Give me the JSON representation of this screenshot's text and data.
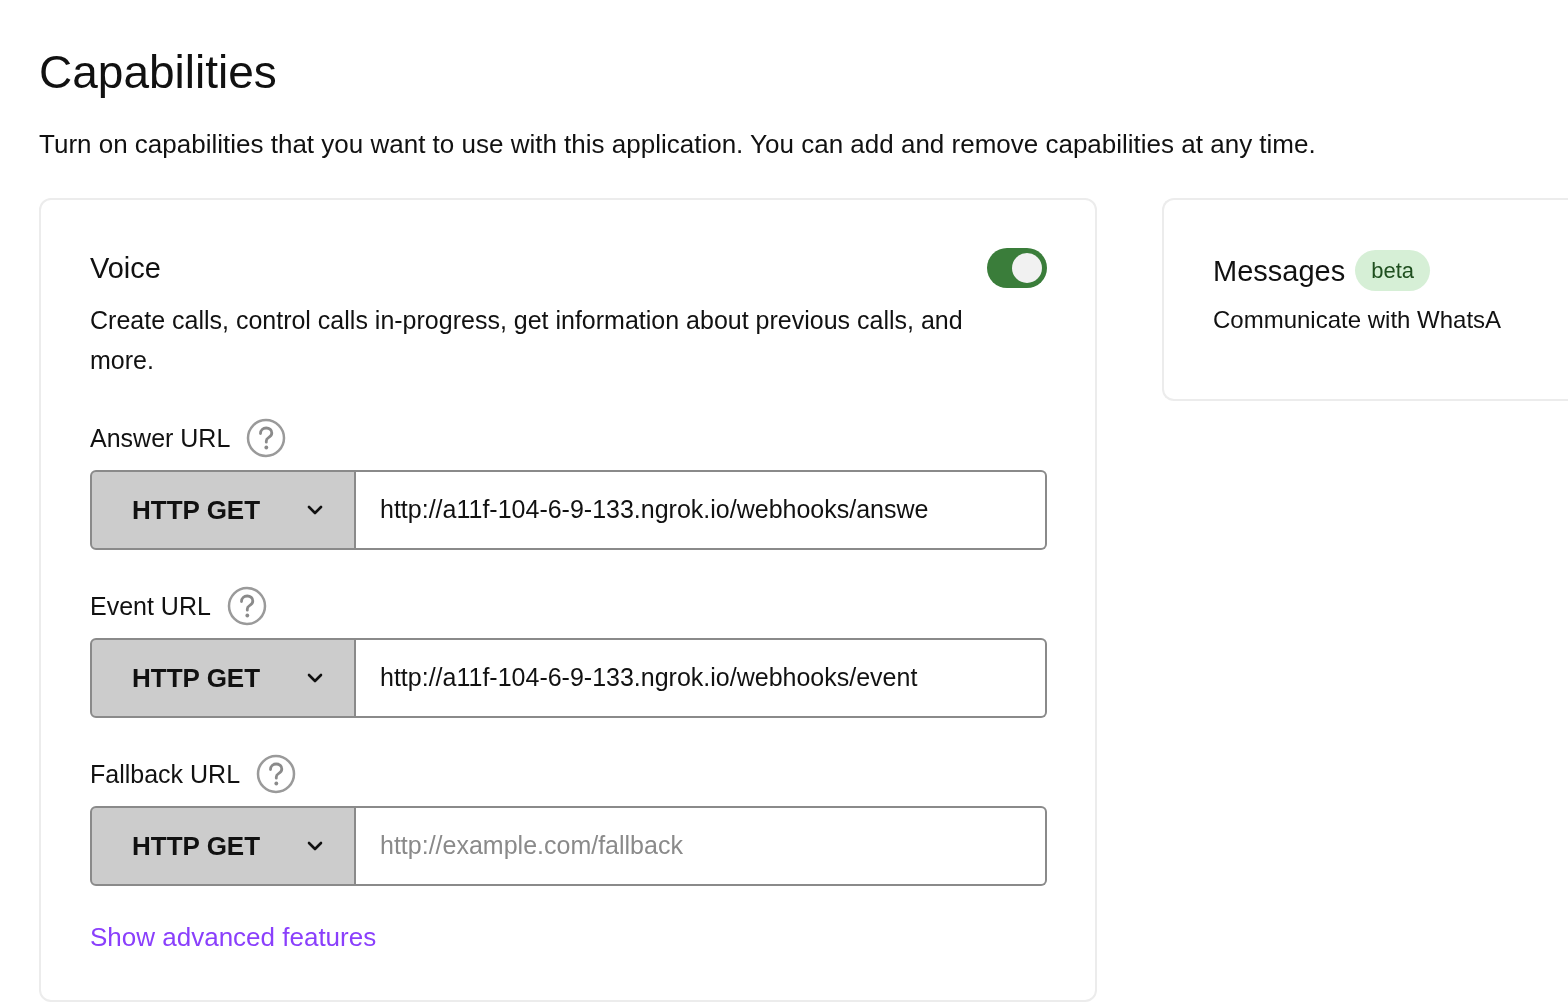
{
  "title": "Capabilities",
  "description": "Turn on capabilities that you want to use with this application. You can add and remove capabilities at any time.",
  "capabilities": [
    {
      "kind": "voice",
      "name": "Voice",
      "on": true,
      "description": "Create calls, control calls in-progress, get information about previous calls, and more.",
      "url_fields": [
        {
          "label": "Answer URL",
          "method": "HTTP GET",
          "value": "http://a11f-104-6-9-133.ngrok.io/webhooks/answe"
        },
        {
          "label": "Event URL",
          "method": "HTTP GET",
          "value": "http://a11f-104-6-9-133.ngrok.io/webhooks/event"
        },
        {
          "label": "Fallback URL",
          "method": "HTTP GET",
          "placeholder": "http://example.com/fallback"
        }
      ],
      "link": "Show advanced features"
    },
    {
      "kind": "messages",
      "name": "Messages",
      "badge": "beta",
      "description": "Communicate with WhatsA"
    }
  ]
}
